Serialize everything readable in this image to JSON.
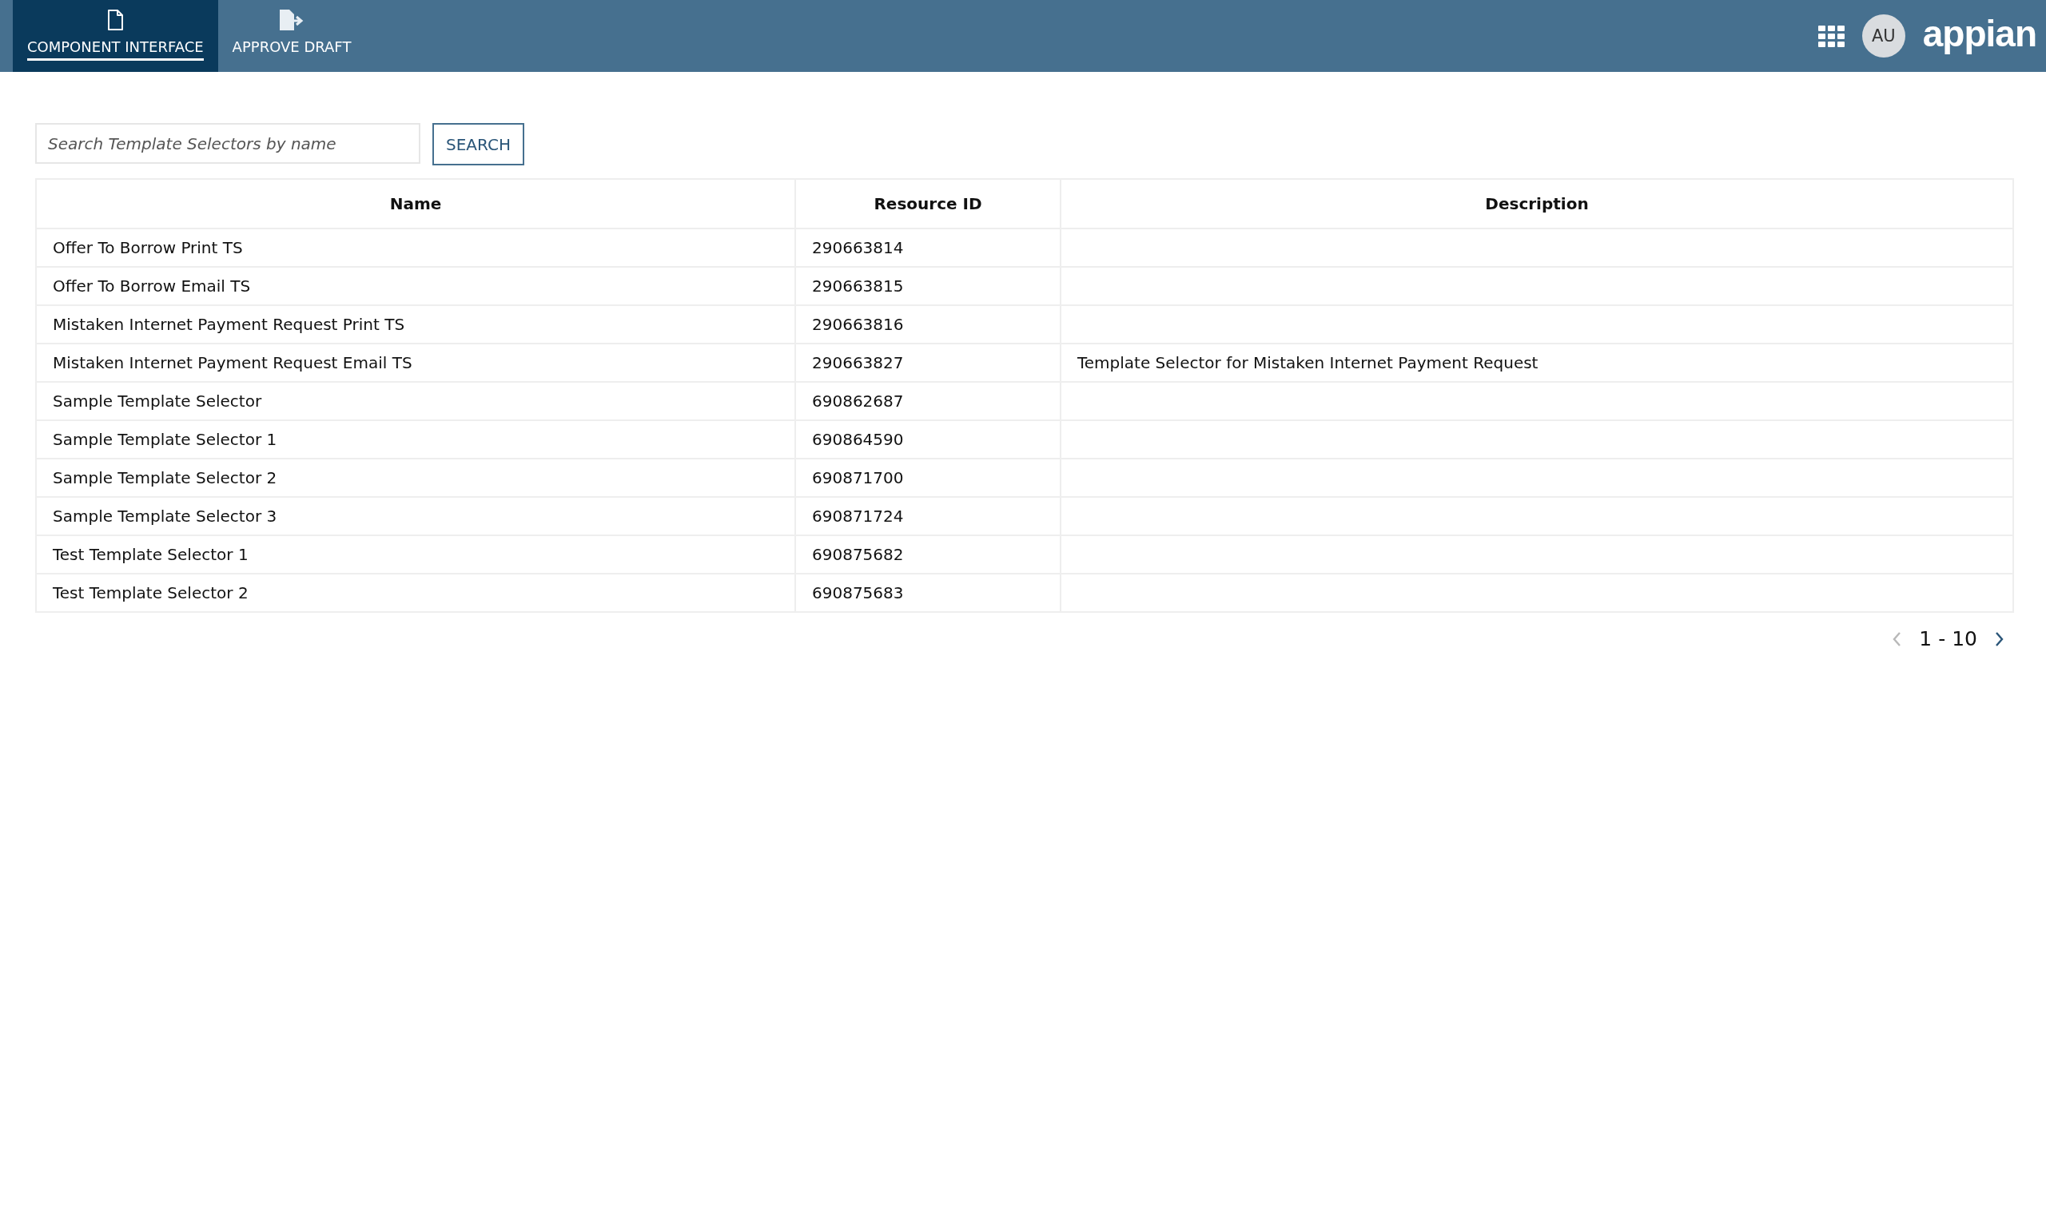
{
  "tabs": [
    {
      "label": "COMPONENT INTERFACE",
      "selected": true,
      "kind": "document"
    },
    {
      "label": "APPROVE DRAFT",
      "selected": false,
      "kind": "export"
    }
  ],
  "header": {
    "avatar": "AU",
    "logo": "appian"
  },
  "search": {
    "placeholder": "Search Template Selectors by name",
    "button": "SEARCH"
  },
  "table": {
    "columns": [
      "Name",
      "Resource ID",
      "Description"
    ],
    "rows": [
      [
        "Offer To Borrow Print TS",
        "290663814",
        ""
      ],
      [
        "Offer To Borrow Email TS",
        "290663815",
        ""
      ],
      [
        "Mistaken Internet Payment Request Print TS",
        "290663816",
        ""
      ],
      [
        "Mistaken Internet Payment Request Email TS",
        "290663827",
        "Template Selector for Mistaken Internet Payment Request"
      ],
      [
        "Sample Template Selector",
        "690862687",
        ""
      ],
      [
        "Sample Template Selector 1",
        "690864590",
        ""
      ],
      [
        "Sample Template Selector 2",
        "690871700",
        ""
      ],
      [
        "Sample Template Selector 3",
        "690871724",
        ""
      ],
      [
        "Test Template Selector 1",
        "690875682",
        ""
      ],
      [
        "Test Template Selector 2",
        "690875683",
        ""
      ]
    ]
  },
  "pagination": {
    "range": "1 - 10",
    "previous_disabled": true,
    "next_disabled": false
  }
}
